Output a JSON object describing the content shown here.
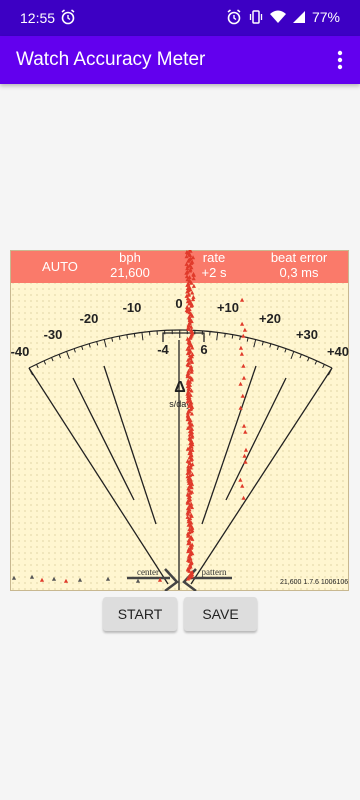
{
  "status_bar": {
    "time": "12:55",
    "battery": "77%"
  },
  "app_bar": {
    "title": "Watch Accuracy Meter"
  },
  "header": {
    "mode": "AUTO",
    "bph_label": "bph",
    "bph_value": "21,600",
    "rate_label": "rate",
    "rate_value": "+2 s",
    "beat_error_label": "beat error",
    "beat_error_value": "0,3 ms"
  },
  "scale": {
    "outer_labels": [
      "-40",
      "-30",
      "-20",
      "-10",
      "0",
      "+10",
      "+20",
      "+30",
      "+40"
    ],
    "inner_labels": [
      "-4",
      "6"
    ],
    "delta_symbol": "Δ",
    "delta_unit": "s/day"
  },
  "bottom": {
    "center_label": "center",
    "pattern_label": "pattern",
    "version": "21,600 1.7.6 1006106"
  },
  "buttons": {
    "start": "START",
    "save": "SAVE"
  },
  "colors": {
    "status_bar": "#3d00c4",
    "app_bar": "#6200ee",
    "header_band": "#fa7a6a",
    "meter_bg": "#fff6d0",
    "marker": "#e03a2a"
  }
}
